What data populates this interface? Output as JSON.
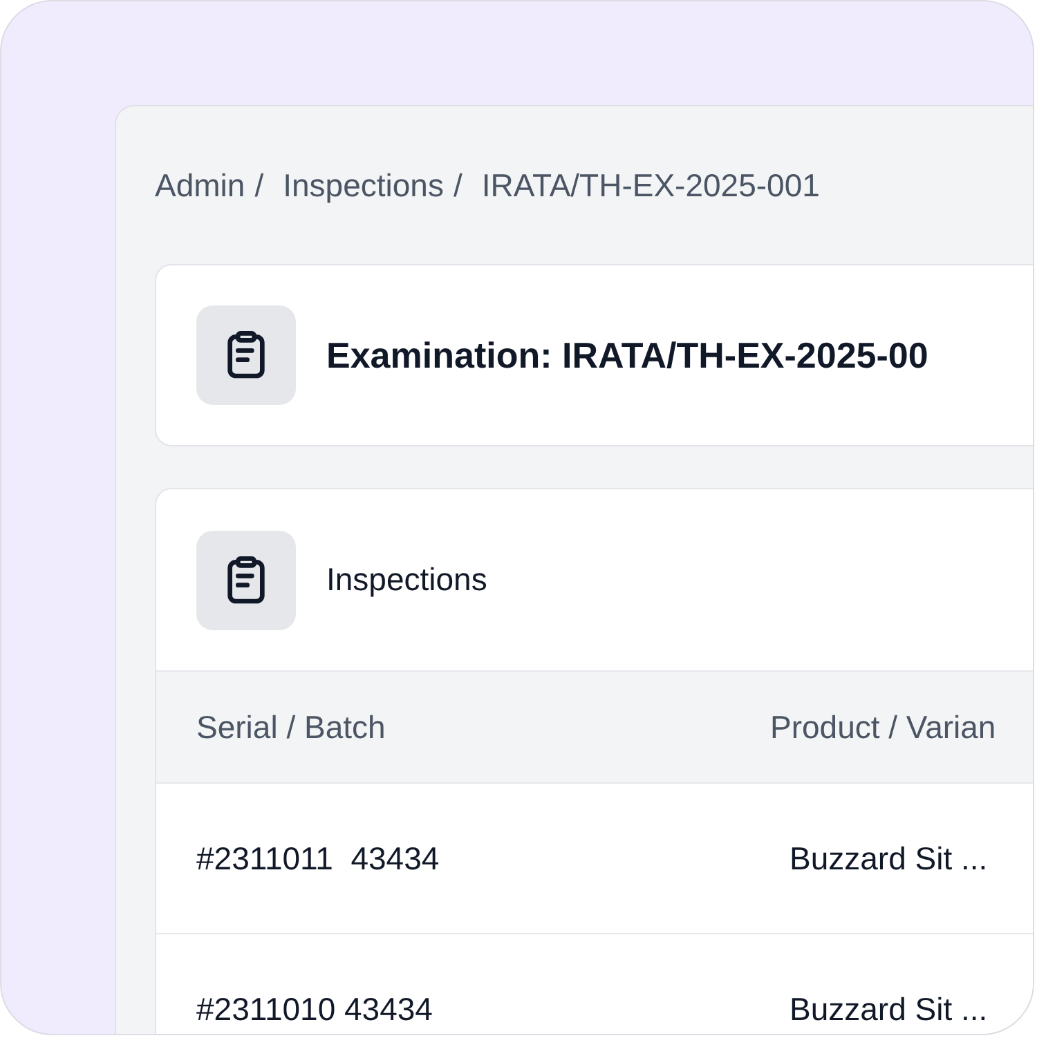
{
  "breadcrumb": [
    {
      "label": "Admin",
      "separator": "/"
    },
    {
      "label": "Inspections",
      "separator": "/"
    },
    {
      "label": "IRATA/TH-EX-2025-001"
    }
  ],
  "header": {
    "title": "Examination: IRATA/TH-EX-2025-00"
  },
  "inspections": {
    "title": "Inspections",
    "columns": [
      "Serial / Batch",
      "Product / Varian"
    ],
    "rows": [
      [
        "#2311011  43434",
        "Buzzard Sit ..."
      ],
      [
        "#2311010 43434",
        "Buzzard Sit ..."
      ]
    ]
  }
}
